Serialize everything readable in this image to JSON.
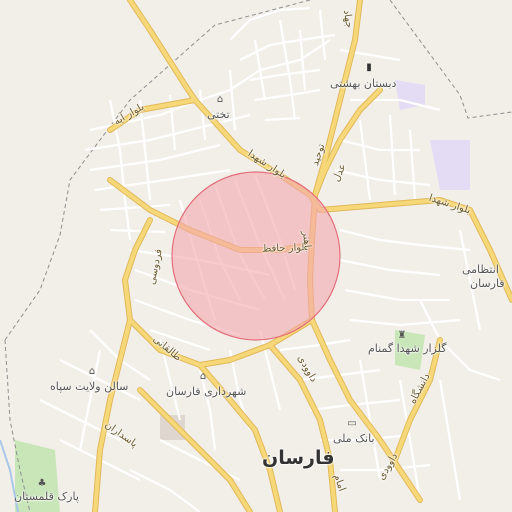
{
  "map": {
    "city_label": "فارسان",
    "poi_labels": {
      "takhti": "تختی",
      "dabestan": "دبستان بهشتی",
      "entezami": "انتظامی",
      "entezami_farsan": "فارسان",
      "golzar": "گلزار شهدا گمنام",
      "shahrdari": "شهرداری فارسان",
      "salon": "سالن ولایت سپاه",
      "bank": "بانک ملی",
      "park": "پارک قلمستان"
    },
    "road_labels": {
      "ayatollah": "بلوار آیه",
      "shohada_nw": "بلوار شهدا",
      "hafez": "بلوار حافظ",
      "shohada_ne": "بلوار شهدا",
      "adl": "عدل",
      "tohid": "توحید",
      "ferdowsi": "فردوسی",
      "taleghani": "طالقانی",
      "pasdaran": "پاسداران",
      "davoodi": "داوودی",
      "davoodi2": "داوودی",
      "daneshgah": "دانشگاه",
      "eslamic": "امام",
      "jahad": "جهاد",
      "bahonar": "باهنر"
    },
    "highlight": {
      "fill": "#f4a6ad",
      "stroke": "#e3707c"
    },
    "colors": {
      "background": "#f2efe9",
      "major_road": "#f7d879",
      "major_road_casing": "#e0b85a",
      "minor_road": "#ffffff",
      "boundary": "#8e8e8e",
      "park": "#c8e6b8",
      "special": "#e4dcf5"
    }
  }
}
